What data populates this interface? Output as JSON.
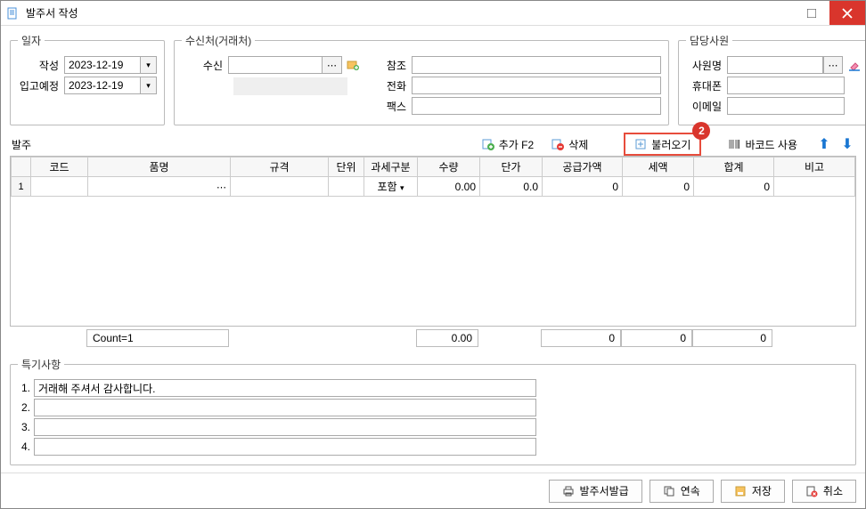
{
  "window": {
    "title": "발주서 작성"
  },
  "date_group": {
    "legend": "일자",
    "creation_label": "작성",
    "creation_value": "2023-12-19",
    "due_label": "입고예정",
    "due_value": "2023-12-19"
  },
  "recipient_group": {
    "legend": "수신처(거래처)",
    "recv_label": "수신",
    "recv_value": "",
    "ref_label": "참조",
    "ref_value": "",
    "tel_label": "전화",
    "tel_value": "",
    "fax_label": "팩스",
    "fax_value": ""
  },
  "staff_group": {
    "legend": "담당사원",
    "name_label": "사원명",
    "name_value": "",
    "mobile_label": "휴대폰",
    "mobile_value": "",
    "email_label": "이메일",
    "email_value": ""
  },
  "order_section_label": "발주",
  "toolbar": {
    "add_label": "추가 F2",
    "del_label": "삭제",
    "load_label": "불러오기",
    "barcode_label": "바코드 사용",
    "highlight_badge": "2"
  },
  "grid": {
    "headers": [
      "",
      "코드",
      "품명",
      "규격",
      "단위",
      "과세구분",
      "수량",
      "단가",
      "공급가액",
      "세액",
      "합계",
      "비고"
    ],
    "row": {
      "idx": "1",
      "code": "",
      "name": "",
      "spec": "",
      "unit": "",
      "tax": "포함",
      "qty": "0.00",
      "price": "0.0",
      "supply": "0",
      "vat": "0",
      "total": "0",
      "note": ""
    }
  },
  "summary": {
    "count": "Count=1",
    "qty": "0.00",
    "supply": "0",
    "vat": "0",
    "total": "0"
  },
  "notes_group": {
    "legend": "특기사항",
    "n1_label": "1.",
    "n1_value": "거래해 주셔서 감사합니다.",
    "n2_label": "2.",
    "n2_value": "",
    "n3_label": "3.",
    "n3_value": "",
    "n4_label": "4.",
    "n4_value": ""
  },
  "buttons": {
    "issue": "발주서발급",
    "cont": "연속",
    "save": "저장",
    "cancel": "취소"
  }
}
